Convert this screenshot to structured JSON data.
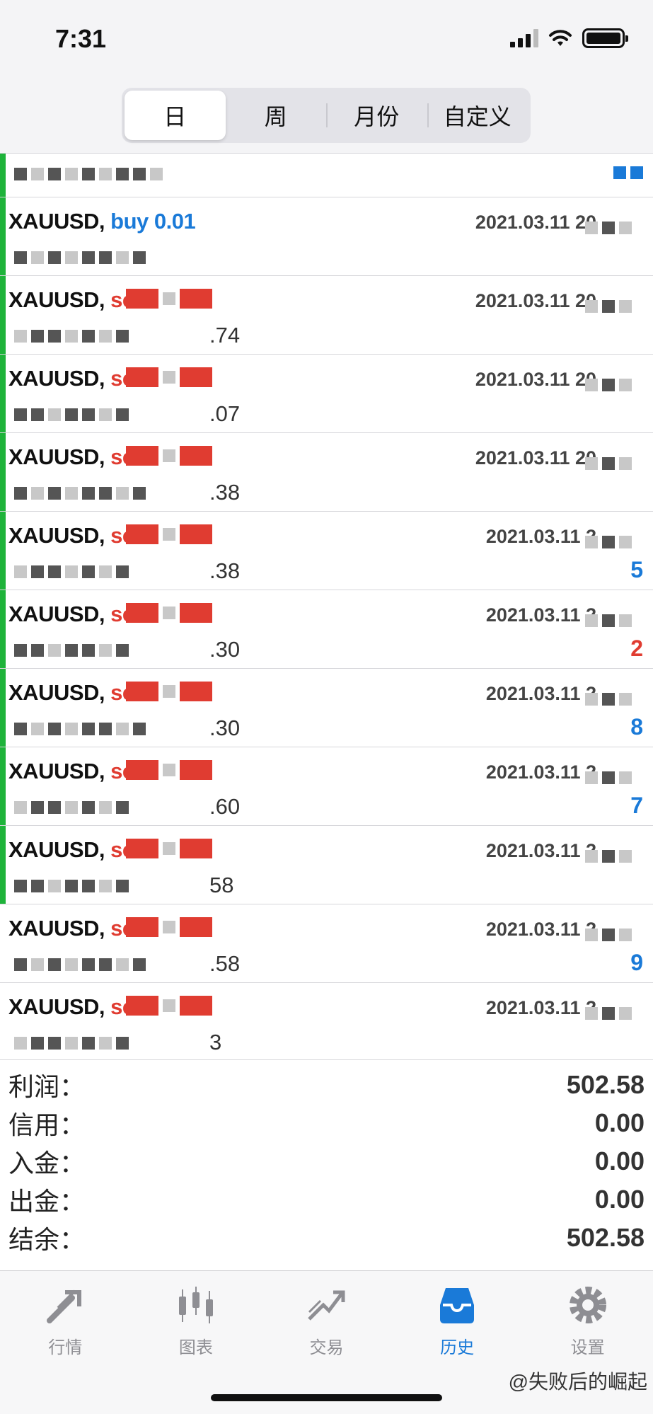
{
  "status": {
    "time": "7:31"
  },
  "segments": [
    "日",
    "周",
    "月份",
    "自定义"
  ],
  "active_segment": 0,
  "rows": [
    {
      "sym": "XAUUSD,",
      "side": "buy 0.01",
      "side_color": "buy",
      "date": "2021.03.11 20",
      "price": "",
      "profit": "",
      "profit_color": "blue"
    },
    {
      "sym": "XAUUSD,",
      "side": "sell",
      "side_color": "sell",
      "date": "2021.03.11 20",
      "price": ".74",
      "profit": "",
      "profit_color": "blue"
    },
    {
      "sym": "XAUUSD,",
      "side": "sell",
      "side_color": "sell",
      "date": "2021.03.11 20",
      "price": ".07",
      "profit": "",
      "profit_color": "blue"
    },
    {
      "sym": "XAUUSD,",
      "side": "sell",
      "side_color": "sell",
      "date": "2021.03.11 20",
      "price": ".38",
      "profit": "",
      "profit_color": "red"
    },
    {
      "sym": "XAUUSD,",
      "side": "sell",
      "side_color": "sell",
      "date": "2021.03.11 2",
      "price": ".38",
      "profit": "5",
      "profit_color": "blue"
    },
    {
      "sym": "XAUUSD,",
      "side": "sell",
      "side_color": "sell",
      "date": "2021.03.11 2",
      "price": ".30",
      "profit": "2",
      "profit_color": "red"
    },
    {
      "sym": "XAUUSD,",
      "side": "sell",
      "side_color": "sell",
      "date": "2021.03.11 2",
      "price": ".30",
      "profit": "8",
      "profit_color": "blue"
    },
    {
      "sym": "XAUUSD,",
      "side": "sell",
      "side_color": "sell",
      "date": "2021.03.11 2",
      "price": ".60",
      "profit": "7",
      "profit_color": "blue"
    },
    {
      "sym": "XAUUSD,",
      "side": "sell",
      "side_color": "sell",
      "date": "2021.03.11 2",
      "price": "58",
      "profit": "",
      "profit_color": "blue"
    },
    {
      "sym": "XAUUSD,",
      "side": "sell",
      "side_color": "sell",
      "date": "2021.03.11 2",
      "price": ".58",
      "profit": "9",
      "profit_color": "blue"
    },
    {
      "sym": "XAUUSD,",
      "side": "sell",
      "side_color": "sell",
      "date": "2021.03.11 2",
      "price": "3",
      "profit": "",
      "profit_color": "blue"
    }
  ],
  "summary": [
    {
      "label": "利润：",
      "value": "502.58"
    },
    {
      "label": "信用：",
      "value": "0.00"
    },
    {
      "label": "入金：",
      "value": "0.00"
    },
    {
      "label": "出金：",
      "value": "0.00"
    },
    {
      "label": "结余：",
      "value": "502.58"
    }
  ],
  "tabs": [
    {
      "label": "行情",
      "icon": "quotes-icon"
    },
    {
      "label": "图表",
      "icon": "chart-icon"
    },
    {
      "label": "交易",
      "icon": "trade-icon"
    },
    {
      "label": "历史",
      "icon": "history-icon"
    },
    {
      "label": "设置",
      "icon": "settings-icon"
    }
  ],
  "active_tab": 3,
  "watermark": "@失败后的崛起",
  "colors": {
    "accent": "#1a7ad8",
    "sell": "#e03c31",
    "bar": "#1eb33a"
  }
}
